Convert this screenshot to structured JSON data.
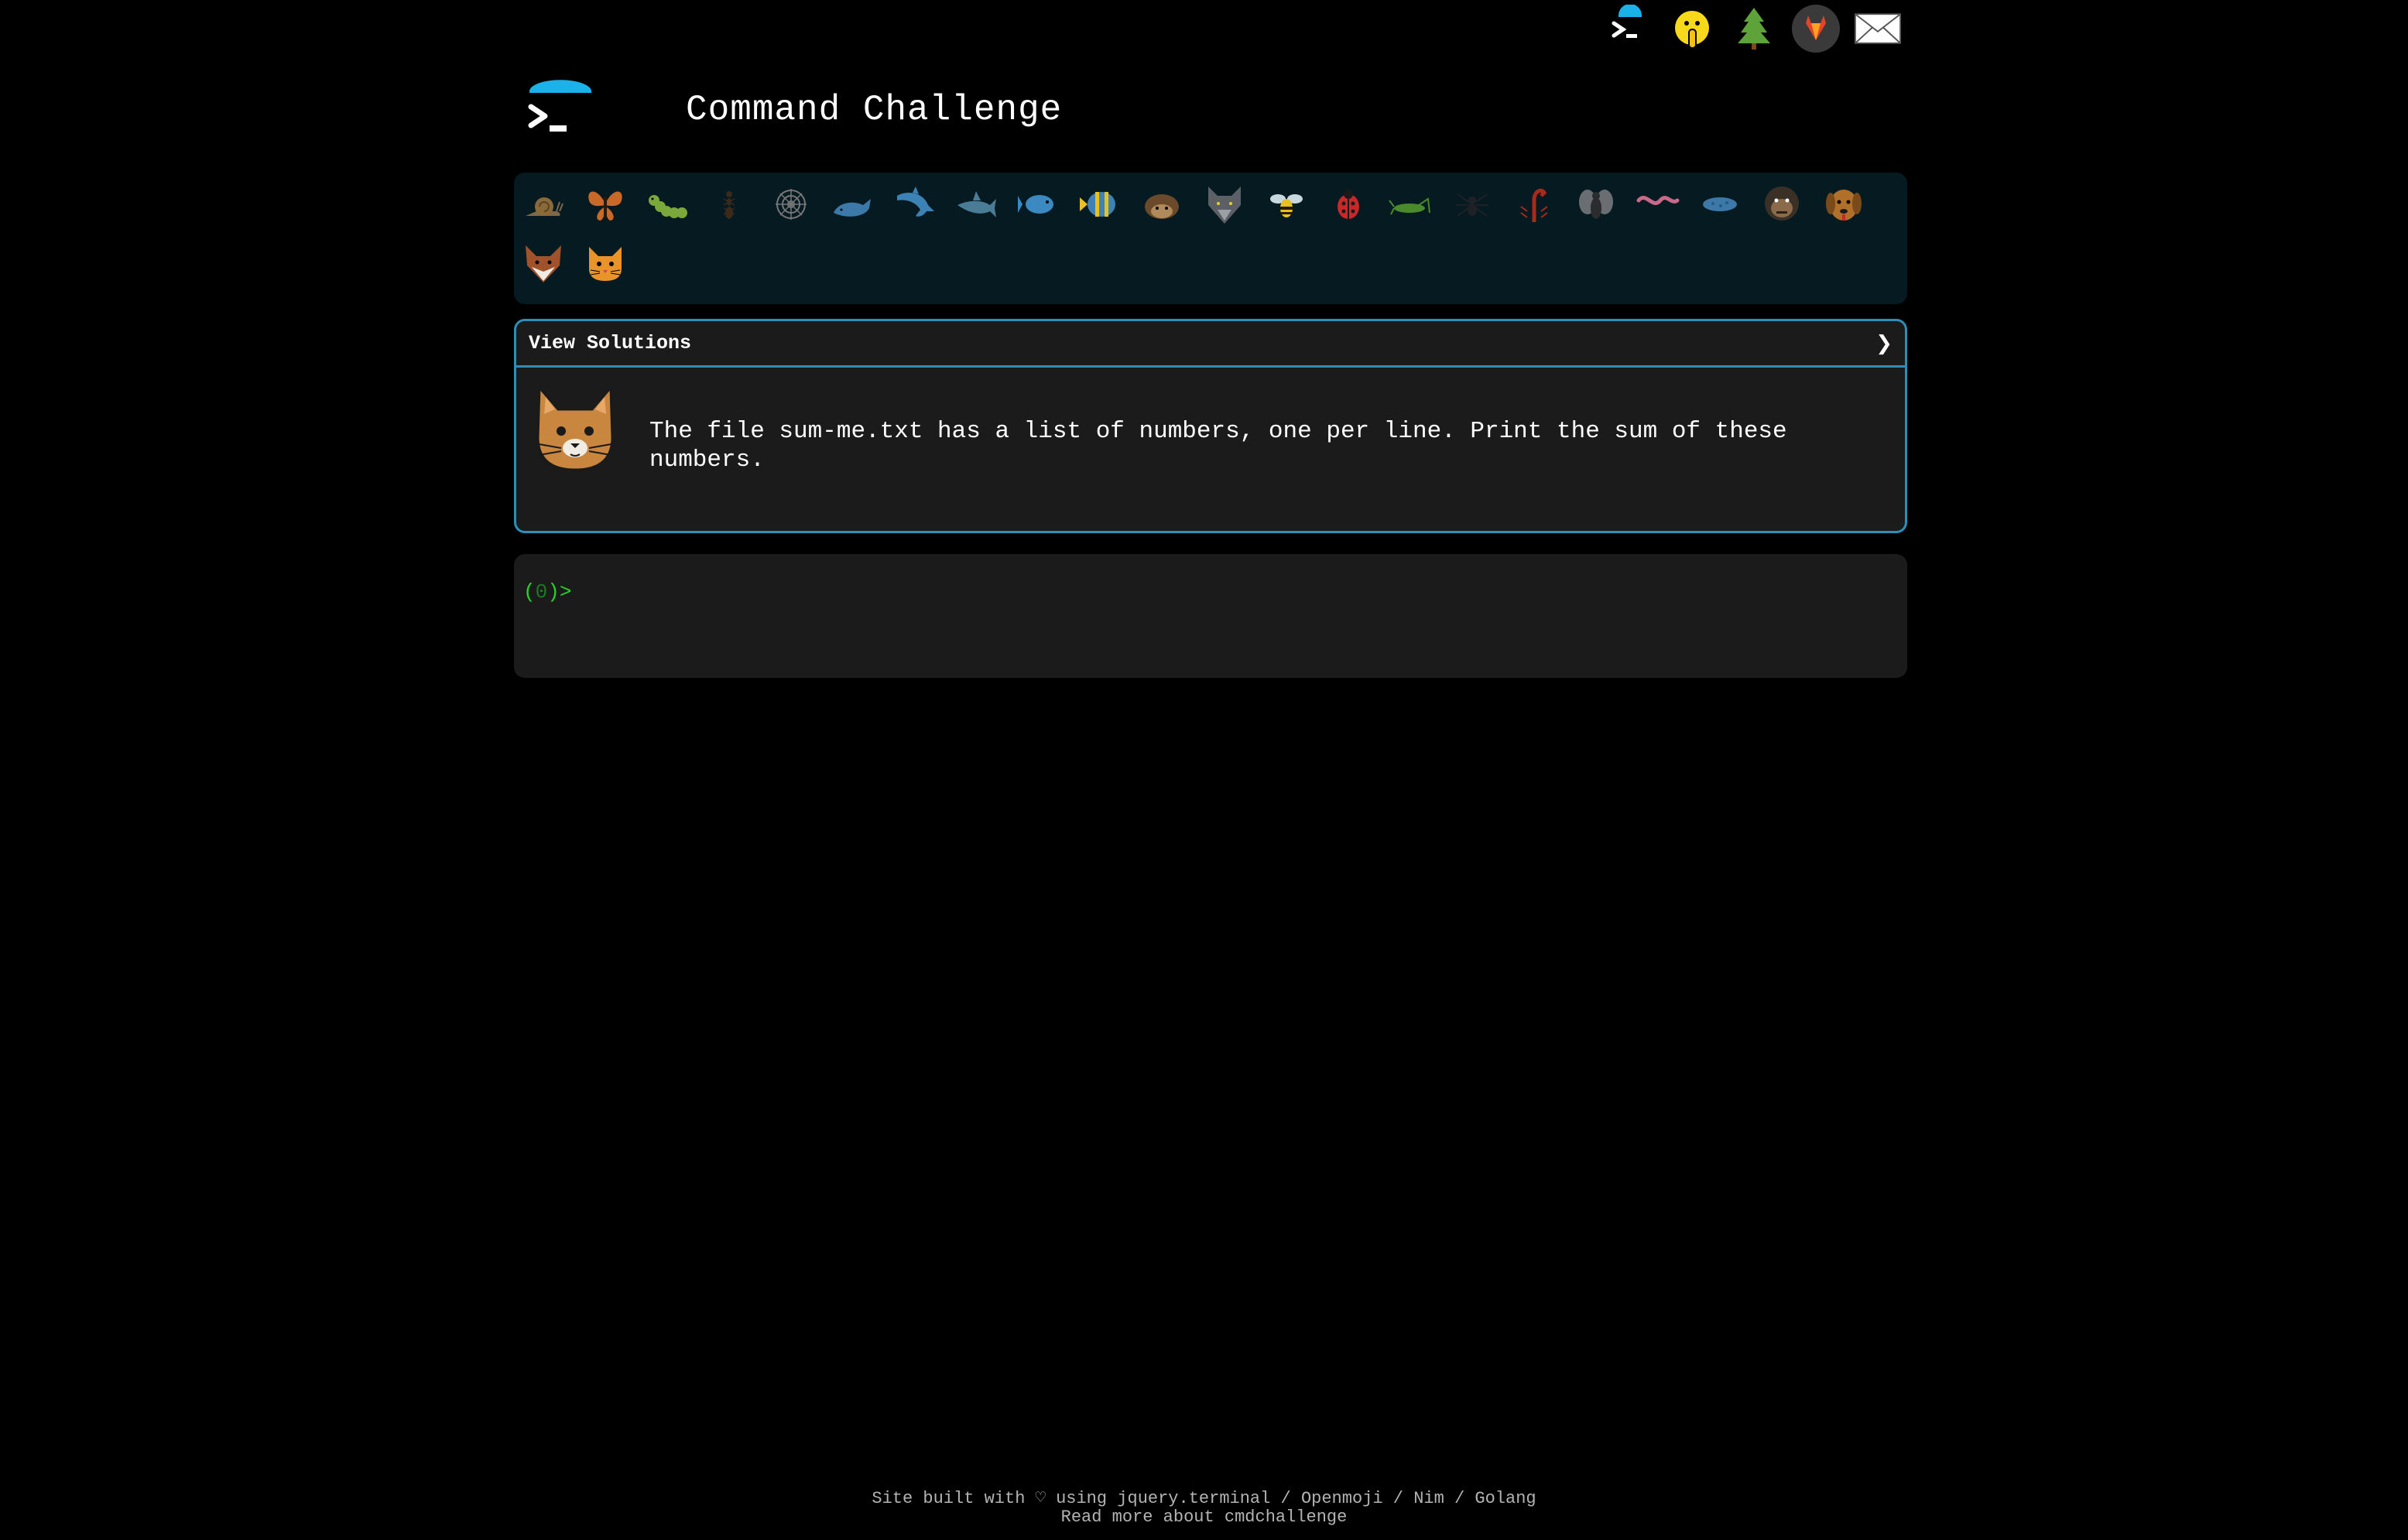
{
  "header": {
    "title": "Command Challenge"
  },
  "top_icons": [
    {
      "name": "terminal-logo-icon"
    },
    {
      "name": "shush-face-icon"
    },
    {
      "name": "tree-icon"
    },
    {
      "name": "gitlab-icon"
    },
    {
      "name": "mail-icon"
    }
  ],
  "animals": [
    "snail",
    "butterfly",
    "caterpillar",
    "ant",
    "spider-web",
    "whale",
    "dolphin",
    "shark",
    "fish",
    "tropical-fish",
    "hedgehog",
    "wolf",
    "bee",
    "ladybug",
    "cricket",
    "spider",
    "scorpion",
    "fly",
    "worm",
    "microbe",
    "gorilla",
    "dog",
    "fox",
    "cat"
  ],
  "card": {
    "view_solutions": "View Solutions",
    "arrow": "❯",
    "challenge_text": "The file sum-me.txt has a list of numbers, one per line. Print the sum of these numbers."
  },
  "terminal": {
    "prompt_open": "(",
    "prompt_count": "0",
    "prompt_close": ")>"
  },
  "footer": {
    "line1_prefix": "Site built with",
    "heart": "♡",
    "line1_using": "using",
    "jquery": "jquery.terminal",
    "sep1": "/",
    "openmoji": "Openmoji",
    "sep2": "/",
    "nim": "Nim",
    "sep3": "/",
    "golang": "Golang",
    "line2_prefix": "Read more about",
    "about_link": "cmdchallenge"
  },
  "colors": {
    "accent": "#2b8fb8",
    "strip_bg": "#051a21",
    "card_bg": "#1b1b1b",
    "prompt_green": "#27d327"
  }
}
